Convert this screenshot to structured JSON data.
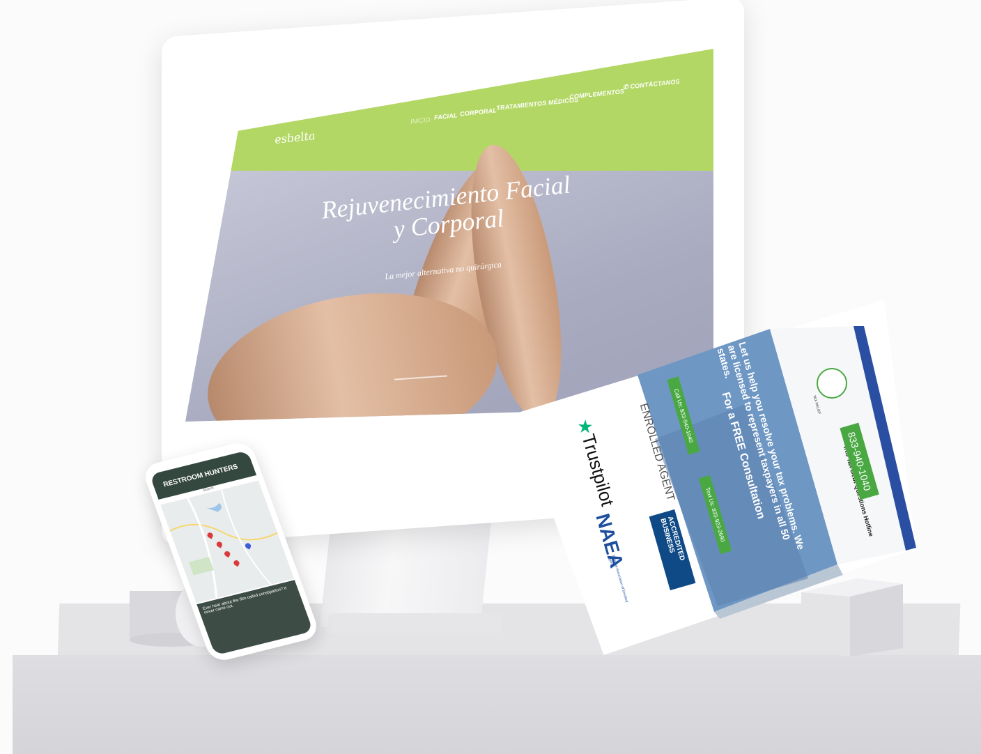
{
  "monitor_site": {
    "logo": "esbelta",
    "nav": [
      {
        "label": "INICIO"
      },
      {
        "label": "FACIAL"
      },
      {
        "label": "CORPORAL"
      },
      {
        "label": "TRATAMIENTOS MÉDICOS"
      },
      {
        "label": "COMPLEMENTOS"
      },
      {
        "label": "CONTÁCTANOS"
      }
    ],
    "hero_title_line1": "Rejuvenecimiento Facial",
    "hero_title_line2": "y Corporal",
    "hero_subtitle": "La mejor alternativa no quirúrgica",
    "colors": {
      "nav": "#b3d764",
      "hero": "#a9abc0"
    }
  },
  "phone_site": {
    "title": "RESTROOM HUNTERS",
    "search_label": "Search",
    "footer_text": "Ever hear about the film called constipation? It never came out."
  },
  "tablet_site": {
    "hotline_label": "IRS Tax Debt Questions Hotline",
    "hotline_number": "833-940-1040",
    "logo_text": "TAX RELIEF",
    "headline": "Let us help you resolve your tax problems. We are licensed to represent taxpayers in all 50 states.",
    "consult": "For a FREE Consultation",
    "call_button": "Call Us: 833-940-1040",
    "text_button": "Text Us: 833-923-2690",
    "badges": {
      "enrolled": "ENROLLED AGENT",
      "trustpilot": "Trustpilot",
      "bbb_line1": "ACCREDITED",
      "bbb_line2": "BUSINESS",
      "naea": "NAEA",
      "naea_full": "National Association of Enrolled Agents"
    },
    "colors": {
      "accent": "#4aa843",
      "header": "#2a4fa2"
    }
  }
}
